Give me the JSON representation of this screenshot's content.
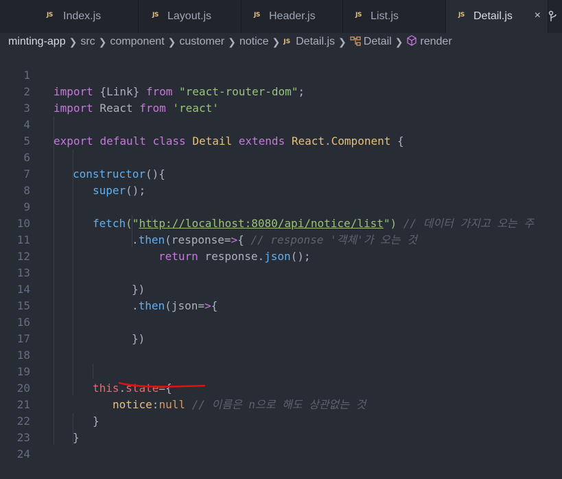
{
  "tabs": [
    {
      "label": "Index.js",
      "active": false
    },
    {
      "label": "Layout.js",
      "active": false
    },
    {
      "label": "Header.js",
      "active": false
    },
    {
      "label": "List.js",
      "active": false
    },
    {
      "label": "Detail.js",
      "active": true
    }
  ],
  "tab_icon_text": "JS",
  "tab_close": "×",
  "breadcrumb": {
    "project": "minting-app",
    "parts": [
      "src",
      "component",
      "customer",
      "notice"
    ],
    "file": "Detail.js",
    "class_name": "Detail",
    "method": "render"
  },
  "code": {
    "l1": [
      "import",
      " {Link} ",
      "from",
      " ",
      "\"react-router-dom\"",
      ";"
    ],
    "l2": [
      "import",
      " React ",
      "from",
      " ",
      "'react'"
    ],
    "l4": [
      "export",
      " ",
      "default",
      " ",
      "class",
      " ",
      "Detail",
      " ",
      "extends",
      " ",
      "React",
      ".",
      "Component",
      " {"
    ],
    "l6": [
      "constructor",
      "(){"
    ],
    "l7": [
      "super",
      "();"
    ],
    "l9": [
      "fetch",
      "(\"",
      "http://localhost:8080/api/notice/list",
      "\") ",
      "// 데이터 가지고 오는 주"
    ],
    "l10": [
      ".",
      "then",
      "(response=",
      ">",
      "{ ",
      "// response '객체'가 오는 것"
    ],
    "l11": [
      "return",
      " response.",
      "json",
      "();"
    ],
    "l13": [
      "})"
    ],
    "l14": [
      ".",
      "then",
      "(json=",
      ">",
      "{"
    ],
    "l16": [
      "})"
    ],
    "l19": [
      "this",
      ".",
      "state",
      "={"
    ],
    "l20": [
      "notice",
      ":",
      "null",
      " ",
      "// 이름은 n으로 해도 상관없는 것"
    ],
    "l21": [
      "}"
    ],
    "l22": [
      "}"
    ]
  },
  "line_numbers": [
    "1",
    "2",
    "3",
    "4",
    "5",
    "6",
    "7",
    "8",
    "9",
    "10",
    "11",
    "12",
    "13",
    "14",
    "15",
    "16",
    "17",
    "18",
    "19",
    "20",
    "21",
    "22",
    "23",
    "24"
  ],
  "colors": {
    "background": "#282c34",
    "keyword": "#c678dd",
    "string": "#98c379",
    "annotation": "#e01010"
  }
}
